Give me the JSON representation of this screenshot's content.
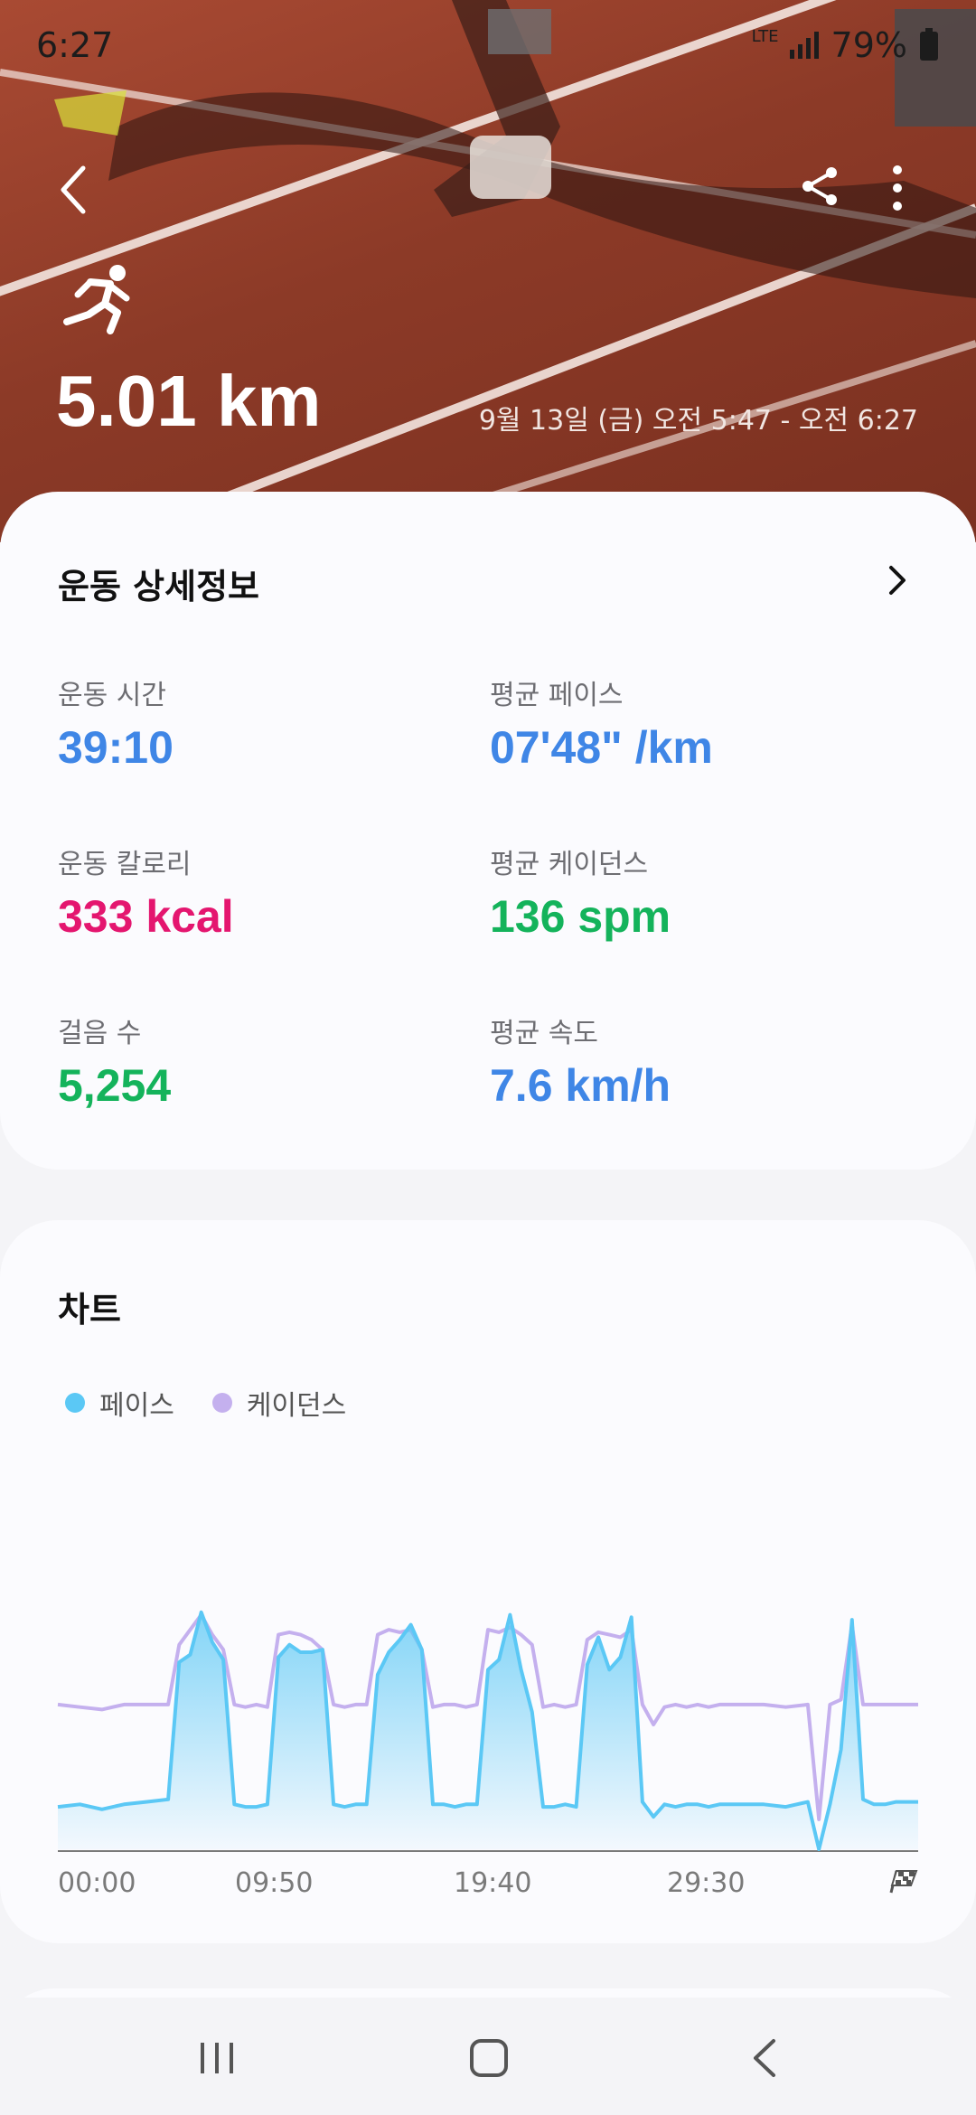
{
  "status_bar": {
    "time": "6:27",
    "network": "LTE",
    "battery": "79%"
  },
  "header": {
    "distance": "5.01 km",
    "date_range": "9월 13일 (금) 오전 5:47 - 오전 6:27",
    "activity_icon": "running-icon"
  },
  "details": {
    "title": "운동 상세정보",
    "metrics": [
      {
        "label": "운동 시간",
        "value": "39:10",
        "color": "#3f86e6"
      },
      {
        "label": "평균 페이스",
        "value": "07'48\" /km",
        "color": "#3f86e6"
      },
      {
        "label": "운동 칼로리",
        "value": "333 kcal",
        "color": "#e4166f"
      },
      {
        "label": "평균 케이던스",
        "value": "136 spm",
        "color": "#14b35b"
      },
      {
        "label": "걸음 수",
        "value": "5,254",
        "color": "#14b35b"
      },
      {
        "label": "평균 속도",
        "value": "7.6 km/h",
        "color": "#3f86e6"
      }
    ]
  },
  "chart": {
    "title": "차트",
    "legend": [
      {
        "label": "페이스",
        "color": "#5bc8f5"
      },
      {
        "label": "케이던스",
        "color": "#c4b0ee"
      }
    ],
    "x_ticks": [
      "00:00",
      "09:50",
      "19:40",
      "29:30"
    ],
    "finish_icon": "checkered-flag-icon"
  },
  "chart_data": {
    "type": "line",
    "x_ticks": [
      "00:00",
      "09:50",
      "19:40",
      "29:30"
    ],
    "series": [
      {
        "name": "페이스",
        "color": "#5bc8f5",
        "fill": true,
        "x": [
          0,
          1,
          2,
          3,
          4,
          5,
          5.5,
          6,
          6.5,
          7,
          7.5,
          8,
          8.5,
          9,
          9.5,
          10,
          10.5,
          11,
          11.5,
          12,
          12.5,
          13,
          13.5,
          14,
          14.5,
          15,
          15.5,
          16,
          16.5,
          17,
          17.5,
          18,
          18.5,
          19,
          19.5,
          20,
          20.5,
          21,
          21.5,
          22,
          22.5,
          23,
          23.5,
          24,
          24.5,
          25,
          25.5,
          26,
          26.5,
          27,
          27.5,
          28,
          28.5,
          29,
          29.5,
          30,
          31,
          32,
          33,
          34,
          34.5,
          35,
          35.5,
          36,
          36.5,
          37,
          37.5,
          38,
          39
        ],
        "y": [
          0.17,
          0.18,
          0.16,
          0.18,
          0.19,
          0.2,
          0.75,
          0.78,
          0.95,
          0.83,
          0.76,
          0.18,
          0.17,
          0.17,
          0.18,
          0.77,
          0.82,
          0.79,
          0.79,
          0.8,
          0.18,
          0.17,
          0.18,
          0.18,
          0.7,
          0.79,
          0.84,
          0.9,
          0.8,
          0.18,
          0.18,
          0.17,
          0.18,
          0.18,
          0.72,
          0.76,
          0.94,
          0.72,
          0.55,
          0.17,
          0.17,
          0.18,
          0.17,
          0.74,
          0.85,
          0.72,
          0.77,
          0.93,
          0.19,
          0.13,
          0.18,
          0.17,
          0.18,
          0.18,
          0.17,
          0.18,
          0.18,
          0.18,
          0.17,
          0.19,
          0.0,
          0.18,
          0.4,
          0.92,
          0.2,
          0.18,
          0.18,
          0.19,
          0.19
        ]
      },
      {
        "name": "케이던스",
        "color": "#c4b0ee",
        "fill": false,
        "x": [
          0,
          1,
          2,
          3,
          4,
          5,
          5.5,
          6,
          6.5,
          7,
          7.5,
          8,
          8.5,
          9,
          9.5,
          10,
          10.5,
          11,
          11.5,
          12,
          12.5,
          13,
          13.5,
          14,
          14.5,
          15,
          15.5,
          16,
          16.5,
          17,
          17.5,
          18,
          18.5,
          19,
          19.5,
          20,
          20.5,
          21,
          21.5,
          22,
          22.5,
          23,
          23.5,
          24,
          24.5,
          25,
          25.5,
          26,
          26.5,
          27,
          27.5,
          28,
          28.5,
          29,
          29.5,
          30,
          31,
          32,
          33,
          34,
          34.5,
          35,
          35.5,
          36,
          36.5,
          37,
          37.5,
          38,
          39
        ],
        "y": [
          0.58,
          0.57,
          0.56,
          0.58,
          0.58,
          0.58,
          0.82,
          0.88,
          0.94,
          0.86,
          0.8,
          0.58,
          0.57,
          0.58,
          0.57,
          0.86,
          0.87,
          0.86,
          0.84,
          0.8,
          0.58,
          0.57,
          0.58,
          0.58,
          0.86,
          0.88,
          0.87,
          0.88,
          0.8,
          0.57,
          0.58,
          0.58,
          0.57,
          0.58,
          0.88,
          0.87,
          0.89,
          0.86,
          0.82,
          0.57,
          0.58,
          0.57,
          0.58,
          0.84,
          0.87,
          0.86,
          0.85,
          0.88,
          0.58,
          0.5,
          0.57,
          0.58,
          0.57,
          0.58,
          0.57,
          0.58,
          0.58,
          0.58,
          0.57,
          0.58,
          0.12,
          0.58,
          0.6,
          0.9,
          0.58,
          0.58,
          0.58,
          0.58,
          0.58
        ]
      }
    ]
  }
}
